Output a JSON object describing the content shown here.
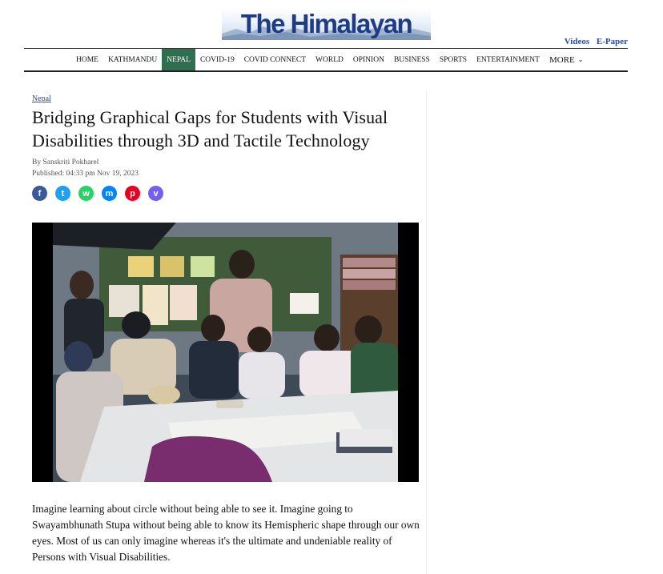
{
  "brand": {
    "logo_text": "The Himalayan"
  },
  "top_links": {
    "videos": "Videos",
    "epaper": "E-Paper"
  },
  "nav": {
    "items": [
      {
        "label": "HOME",
        "active": false
      },
      {
        "label": "KATHMANDU",
        "active": false
      },
      {
        "label": "NEPAL",
        "active": true
      },
      {
        "label": "COVID-19",
        "active": false
      },
      {
        "label": "COVID CONNECT",
        "active": false
      },
      {
        "label": "WORLD",
        "active": false
      },
      {
        "label": "OPINION",
        "active": false
      },
      {
        "label": "BUSINESS",
        "active": false
      },
      {
        "label": "SPORTS",
        "active": false
      },
      {
        "label": "ENTERTAINMENT",
        "active": false
      }
    ],
    "more_label": "MORE",
    "active_color": "#2f6f4f"
  },
  "article": {
    "section": "Nepal",
    "title": "Bridging Graphical Gaps for Students with Visual Disabilities through 3D and Tactile Technology",
    "byline": "By Sanskriti Pokharel",
    "published": "Published: 04:33 pm Nov 19, 2023",
    "share": [
      {
        "name": "facebook-icon",
        "glyph": "f",
        "color": "#3b5998"
      },
      {
        "name": "twitter-icon",
        "glyph": "t",
        "color": "#1da1f2"
      },
      {
        "name": "whatsapp-icon",
        "glyph": "w",
        "color": "#25d366"
      },
      {
        "name": "messenger-icon",
        "glyph": "m",
        "color": "#0084ff"
      },
      {
        "name": "pinterest-icon",
        "glyph": "p",
        "color": "#e60023"
      },
      {
        "name": "viber-icon",
        "glyph": "v",
        "color": "#7360f2"
      }
    ],
    "body": "Imagine learning about circle without being able to see it. Imagine going to Swayambhunath Stupa without being able to know its Hemispheric shape through our own eyes. Most of us can only imagine whereas it's the ultimate and undeniable reality of Persons with Visual Disabilities."
  }
}
